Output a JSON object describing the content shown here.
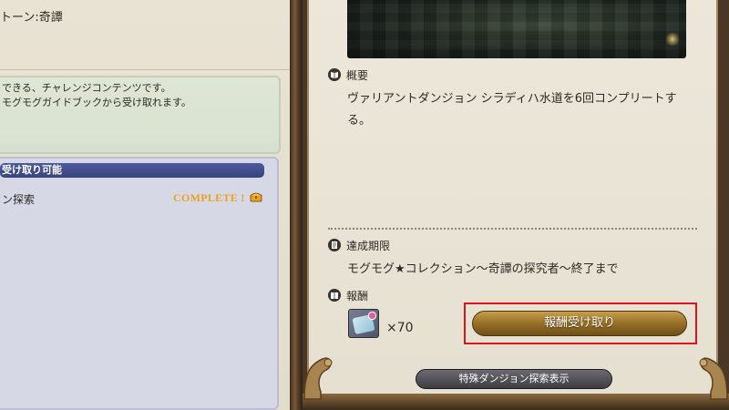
{
  "left": {
    "title": "トーン:奇譚",
    "description": [
      "できる、チャレンジコンテンツです。",
      "モグモグガイドブックから受け取れます。"
    ],
    "list_header": "受け取り可能",
    "row": {
      "label": "ン探索",
      "status": "COMPLETE !"
    }
  },
  "right": {
    "summary": {
      "label": "概要",
      "text_lines": [
        "ヴァリアントダンジョン シラディハ水道を6回コンプリートす",
        "る。"
      ]
    },
    "deadline": {
      "label": "達成期限",
      "text": "モグモグ★コレクション～奇譚の探究者～終了まで"
    },
    "reward": {
      "label": "報酬",
      "count": "×70",
      "claim_button": "報酬受け取り"
    },
    "special_button": "特殊ダンジョン探索表示"
  },
  "colors": {
    "complete": "#e9a21f",
    "highlight": "#e0141b",
    "list_header": "#39447e",
    "claim_button": "#9a7328"
  },
  "icons": {
    "summary": "book-icon",
    "deadline": "document-icon",
    "reward": "reward-icon",
    "chest": "chest-icon"
  }
}
